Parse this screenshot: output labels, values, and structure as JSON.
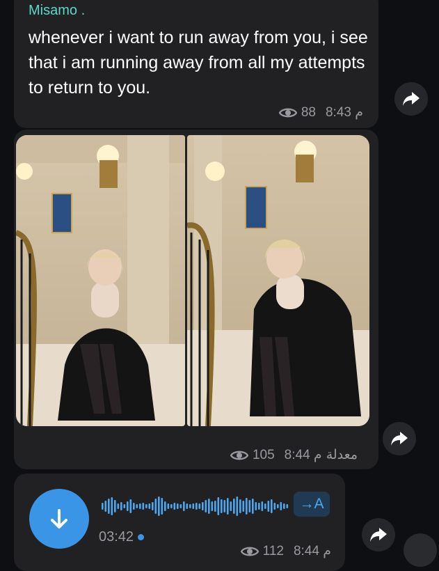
{
  "message1": {
    "sender": "Misamo .",
    "text": "whenever i want to run away from you, i see that i am running away from all my attempts to return to you.",
    "views": "88",
    "time": "م 8:43"
  },
  "message2": {
    "views": "105",
    "time": "م 8:44",
    "edited_label": "معدلة"
  },
  "message3": {
    "duration": "03:42",
    "transcribe_label": "→A",
    "views": "112",
    "time": "م 8:44"
  },
  "icons": {
    "views": "eye-icon",
    "forward": "share-arrow-icon",
    "download": "down-arrow-icon"
  },
  "colors": {
    "sender": "#5ed8c4",
    "bubble": "#212124",
    "accent": "#3b95e6",
    "meta_text": "#9a9aa0"
  }
}
